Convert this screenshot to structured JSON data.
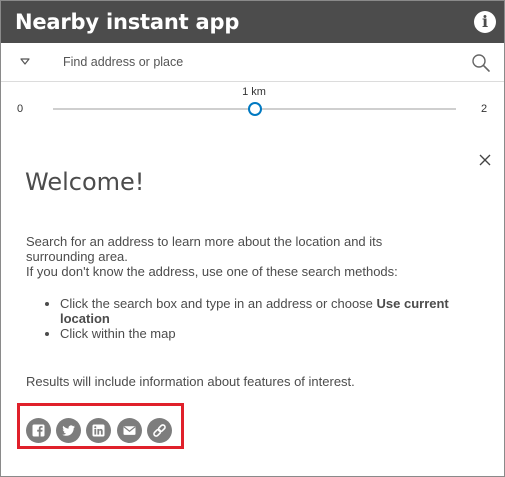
{
  "app": {
    "title": "Nearby instant app",
    "info_icon_glyph": "i"
  },
  "search": {
    "placeholder": "Find address or place",
    "value": ""
  },
  "distance": {
    "min": "0",
    "max": "2",
    "value_label": "1 km",
    "value": 1
  },
  "welcome": {
    "title": "Welcome!",
    "intro": "Search for an address to learn more about the location and its surrounding area.",
    "hint": "If you don't know the address, use one of these search methods:",
    "method_1_text": "Click the search box and type in an address or choose ",
    "method_1_bold": "Use current location",
    "method_2": "Click within the map",
    "results": "Results will include information about features of interest."
  },
  "share": {
    "items": [
      "facebook-icon",
      "twitter-icon",
      "linkedin-icon",
      "email-icon",
      "link-icon"
    ]
  },
  "colors": {
    "header_bg": "#4c4c4c",
    "accent": "#0079c1",
    "highlight_border": "#e0202a",
    "share_icon_bg": "#7d7d7d",
    "text": "#4c4c4c"
  }
}
